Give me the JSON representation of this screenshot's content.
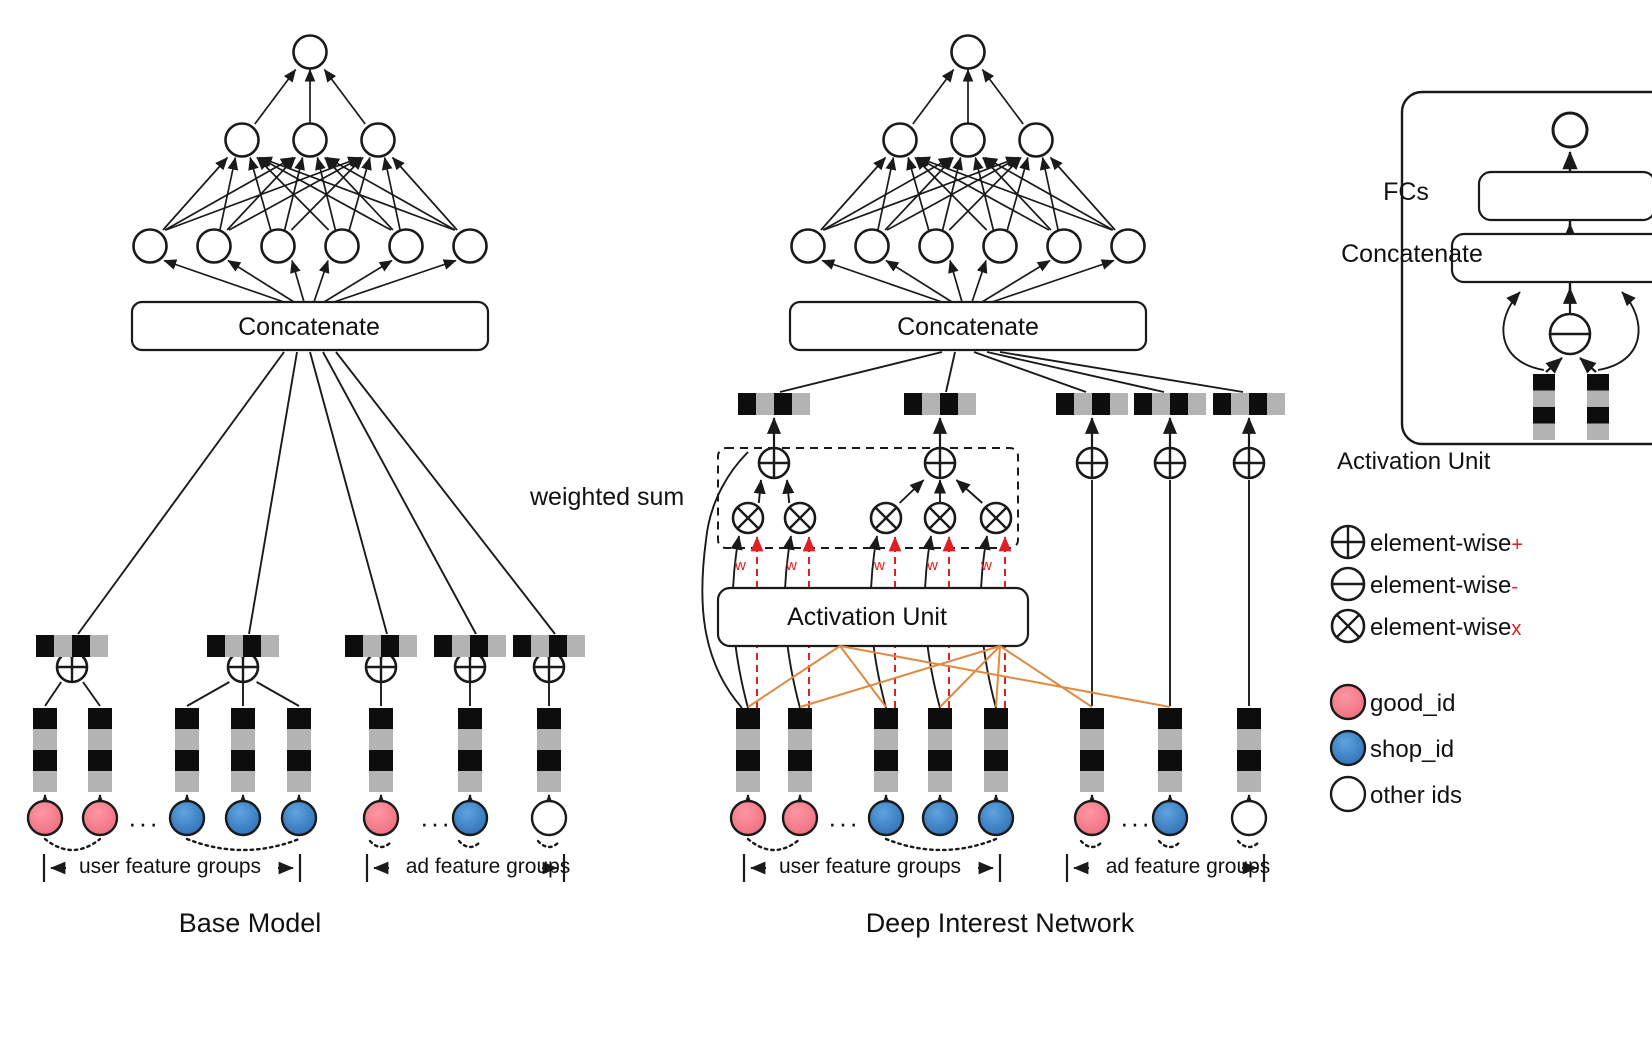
{
  "diagram": {
    "type": "neural-network-architecture",
    "models": [
      {
        "id": "base",
        "title": "Base Model",
        "mlp_layers": [
          6,
          3,
          1
        ],
        "concat_label": "Concatenate",
        "pooling_op": "element-wise +",
        "user_group_label": "user feature groups",
        "ad_group_label": "ad feature groups",
        "user_inputs": [
          "good_id",
          "good_id",
          "ellipsis",
          "shop_id",
          "shop_id",
          "shop_id"
        ],
        "ad_inputs": [
          "good_id",
          "ellipsis",
          "shop_id",
          "other ids"
        ],
        "ellipsis": "···"
      },
      {
        "id": "din",
        "title": "Deep Interest Network",
        "mlp_layers": [
          6,
          3,
          1
        ],
        "concat_label": "Concatenate",
        "weighted_sum_label": "weighted sum",
        "activation_unit_label": "Activation Unit",
        "weight_label": "w",
        "user_group_label": "user feature groups",
        "ad_group_label": "ad feature groups",
        "user_inputs": [
          "good_id",
          "good_id",
          "ellipsis",
          "shop_id",
          "shop_id",
          "shop_id"
        ],
        "ad_inputs": [
          "good_id",
          "ellipsis",
          "shop_id",
          "other ids"
        ],
        "ellipsis": "···"
      }
    ],
    "activation_unit_panel": {
      "caption": "Activation Unit",
      "fcs_label": "FCs",
      "concat_label": "Concatenate",
      "op": "element-wise -"
    },
    "legend": {
      "ops": [
        {
          "icon": "circle-plus-icon",
          "text": "element-wise",
          "sym": "+"
        },
        {
          "icon": "circle-minus-icon",
          "text": "element-wise",
          "sym": "-"
        },
        {
          "icon": "circle-times-icon",
          "text": "element-wise",
          "sym": "x"
        }
      ],
      "ids": [
        {
          "icon": "pink-circle-icon",
          "label": "good_id",
          "color": "#ee7281"
        },
        {
          "icon": "blue-circle-icon",
          "label": "shop_id",
          "color": "#3d7fc1"
        },
        {
          "icon": "white-circle-icon",
          "label": "other ids",
          "color": "#ffffff"
        }
      ]
    },
    "colors": {
      "good_id": "#ee7281",
      "shop_id": "#3d7fc1",
      "other_ids": "#ffffff",
      "stroke": "#1a1a1a",
      "weight_red": "#e02020",
      "attention_orange": "#e08a42",
      "emb_dark": "#0d0d0d",
      "emb_light": "#b3b3b3"
    }
  }
}
